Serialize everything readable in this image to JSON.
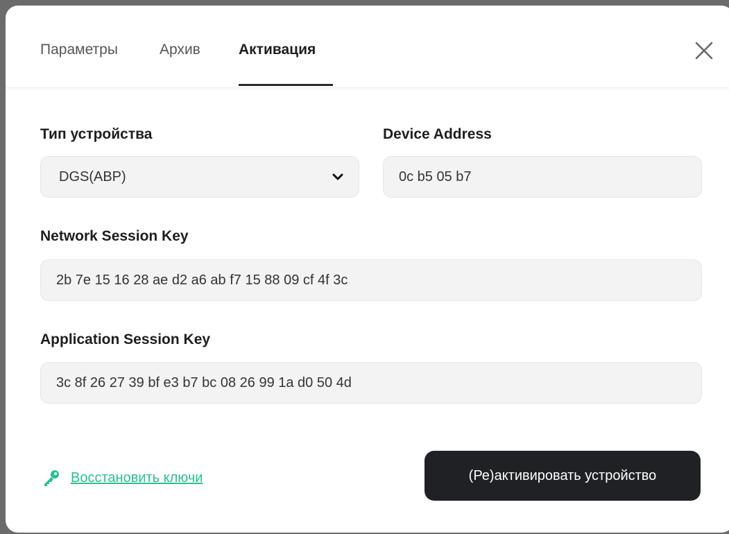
{
  "tabs": [
    {
      "label": "Параметры",
      "active": false
    },
    {
      "label": "Архив",
      "active": false
    },
    {
      "label": "Активация",
      "active": true
    }
  ],
  "icons": {
    "close": "close-icon",
    "dropdown": "chevron-down-icon",
    "restore": "key-icon"
  },
  "form": {
    "device_type": {
      "label": "Тип устройства",
      "selected": "DGS(ABP)"
    },
    "device_address": {
      "label": "Device Address",
      "value": "0c b5 05 b7"
    },
    "network_session_key": {
      "label": "Network Session Key",
      "value": "2b 7e 15 16 28 ae d2 a6 ab f7 15 88 09 cf 4f 3c"
    },
    "application_session_key": {
      "label": "Application Session Key",
      "value": "3c 8f 26 27 39 bf e3 b7 bc 08 26 99 1a d0 50 4d"
    }
  },
  "footer": {
    "restore_link": "Восстановить ключи",
    "activate_button": "(Ре)активировать устройство"
  },
  "colors": {
    "accent_link": "#2bc08f",
    "button_bg": "#1f2125",
    "field_bg": "#f3f3f3"
  }
}
